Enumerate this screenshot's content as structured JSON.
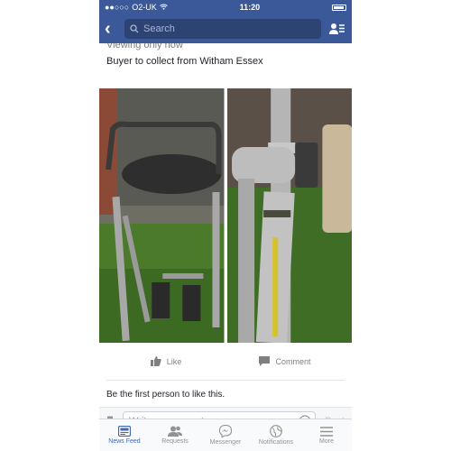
{
  "status": {
    "carrier": "O2-UK",
    "time": "11:20"
  },
  "search": {
    "placeholder": "Search"
  },
  "post": {
    "cut_text": "Viewing only now",
    "text": "Buyer to collect from Witham Essex"
  },
  "actions": {
    "like": "Like",
    "comment": "Comment"
  },
  "likes_line": "Be the first person to like this.",
  "comment_bar": {
    "placeholder": "Write a comment...",
    "post": "Post"
  },
  "tabs": [
    {
      "label": "News Feed",
      "icon": "news-feed-icon"
    },
    {
      "label": "Requests",
      "icon": "friend-requests-icon"
    },
    {
      "label": "Messenger",
      "icon": "messenger-icon"
    },
    {
      "label": "Notifications",
      "icon": "globe-icon"
    },
    {
      "label": "More",
      "icon": "menu-icon"
    }
  ],
  "colors": {
    "brand": "#3b5998",
    "active_tab": "#4267b2"
  }
}
